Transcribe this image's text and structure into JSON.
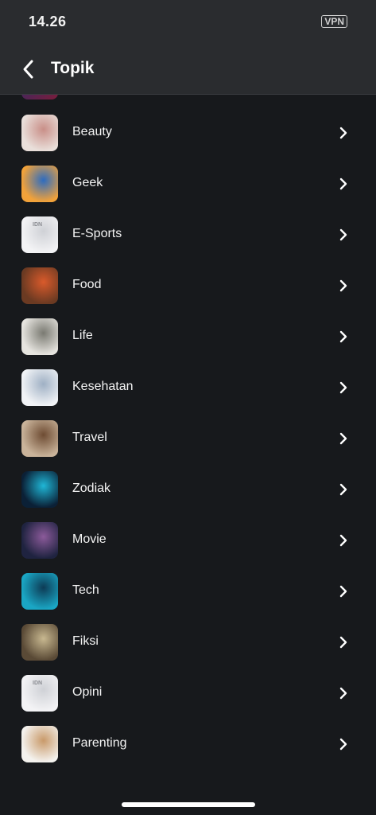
{
  "status_bar": {
    "time": "14.26",
    "vpn": "VPN"
  },
  "header": {
    "title": "Topik"
  },
  "topics": [
    {
      "label": "Beauty",
      "thumb_bg": "#e9dfda",
      "thumb_accent": "#c98f88"
    },
    {
      "label": "Geek",
      "thumb_bg": "#f2a23a",
      "thumb_accent": "#2d6cc0"
    },
    {
      "label": "E-Sports",
      "thumb_bg": "#f3f3f5",
      "thumb_accent": "#cfd1d6",
      "thumb_text": "IDN"
    },
    {
      "label": "Food",
      "thumb_bg": "#6b3a22",
      "thumb_accent": "#d95a2b"
    },
    {
      "label": "Life",
      "thumb_bg": "#e6e4df",
      "thumb_accent": "#7a7a72"
    },
    {
      "label": "Kesehatan",
      "thumb_bg": "#f1f3f6",
      "thumb_accent": "#9fb0c4"
    },
    {
      "label": "Travel",
      "thumb_bg": "#c9b39a",
      "thumb_accent": "#6e4c33"
    },
    {
      "label": "Zodiak",
      "thumb_bg": "#0b2036",
      "thumb_accent": "#1fb6d6"
    },
    {
      "label": "Movie",
      "thumb_bg": "#1f2340",
      "thumb_accent": "#8b5a9a"
    },
    {
      "label": "Tech",
      "thumb_bg": "#1aa6c4",
      "thumb_accent": "#0d3b55"
    },
    {
      "label": "Fiksi",
      "thumb_bg": "#5a4a36",
      "thumb_accent": "#c8b890"
    },
    {
      "label": "Opini",
      "thumb_bg": "#f3f3f5",
      "thumb_accent": "#cfd1d6",
      "thumb_text": "IDN"
    },
    {
      "label": "Parenting",
      "thumb_bg": "#f4f2ee",
      "thumb_accent": "#c99a6a"
    }
  ]
}
